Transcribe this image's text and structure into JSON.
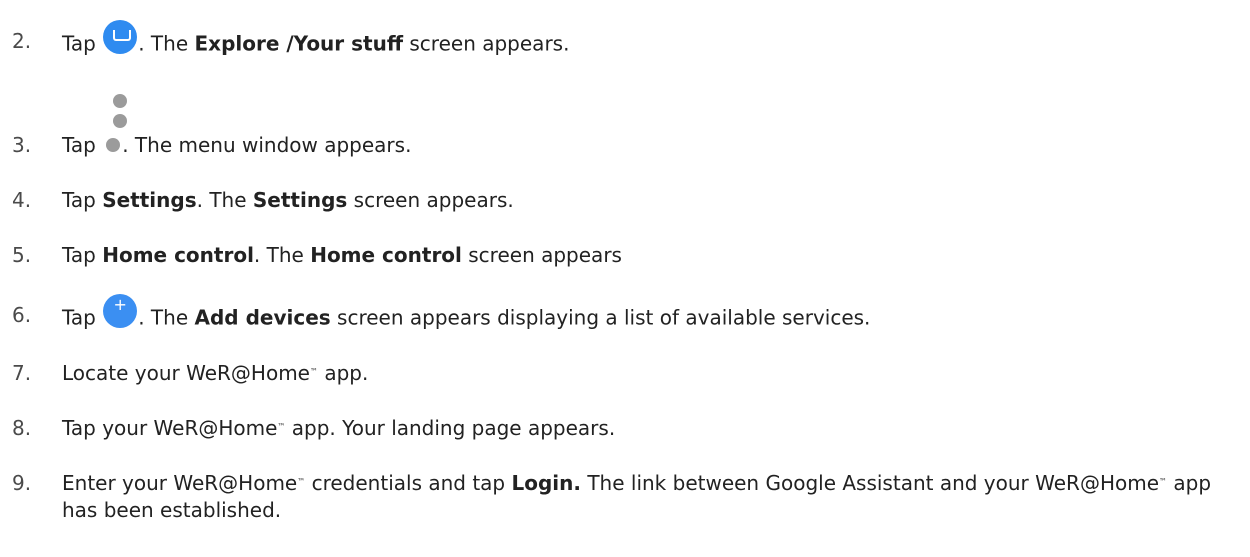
{
  "steps": [
    {
      "number": "2.",
      "parts": [
        "Tap ",
        ". The ",
        "Explore /Your stuff",
        " screen appears."
      ],
      "icon": "assistant-inbox-icon"
    },
    {
      "number": "3.",
      "parts": [
        "Tap ",
        ". The menu window appears."
      ],
      "icon": "more-vertical-dots-icon"
    },
    {
      "number": "4.",
      "parts": [
        "Tap ",
        "Settings",
        ". The ",
        "Settings",
        " screen appears."
      ]
    },
    {
      "number": "5.",
      "parts": [
        "Tap ",
        "Home control",
        ". The ",
        "Home control",
        " screen appears"
      ]
    },
    {
      "number": "6.",
      "parts": [
        "Tap ",
        ". The ",
        "Add devices",
        " screen appears displaying a list of available services."
      ],
      "icon": "plus-icon",
      "icon_glyph": "+"
    },
    {
      "number": "7.",
      "parts": [
        "Locate your WeR@Home",
        "™",
        " app."
      ]
    },
    {
      "number": "8.",
      "parts": [
        "Tap your WeR@Home",
        "™",
        " app. Your landing page appears."
      ]
    },
    {
      "number": "9.",
      "parts": [
        "Enter your WeR@Home",
        "™",
        " credentials and tap ",
        "Login.",
        " The link between Google Assistant and your WeR@Home",
        "™",
        " app has been established."
      ]
    }
  ],
  "colors": {
    "assistant_icon": "#2f8bf0",
    "plus_icon": "#3b8ff2",
    "dot_icon": "#9b9b9b",
    "text": "#222222"
  }
}
